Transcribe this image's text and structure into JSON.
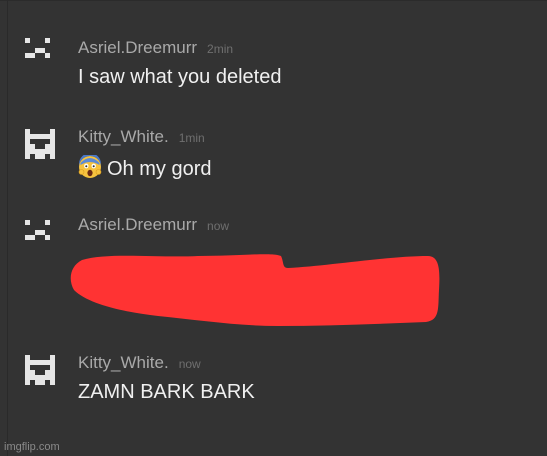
{
  "messages": [
    {
      "author": "Asriel.Dreemurr",
      "time": "2min",
      "text": "I saw what you deleted",
      "avatar": "robot-face-icon"
    },
    {
      "author": "Kitty_White.",
      "time": "1min",
      "text": "Oh my gord",
      "emoji": "screaming-face-emoji",
      "avatar": "cat-face-icon"
    },
    {
      "author": "Asriel.Dreemurr",
      "time": "now",
      "text": "",
      "redacted_color": "#ff3333",
      "avatar": "robot-face-icon"
    },
    {
      "author": "Kitty_White.",
      "time": "now",
      "text": "ZAMN BARK BARK",
      "avatar": "cat-face-icon"
    }
  ],
  "watermark": "imgflip.com",
  "colors": {
    "background": "#333333",
    "author": "#a9a9a9",
    "timestamp": "#6f6f6f",
    "message_text": "#f0f0f0",
    "redaction": "#ff3333"
  }
}
